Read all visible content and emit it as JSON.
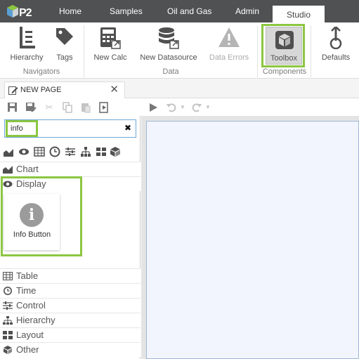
{
  "app": {
    "logo_text": "P2"
  },
  "nav": {
    "tabs": [
      "Home",
      "Samples",
      "Oil and Gas",
      "Admin",
      "Studio"
    ],
    "active": "Studio"
  },
  "ribbon": {
    "buttons": {
      "hierarchy": "Hierarchy",
      "tags": "Tags",
      "new_calc": "New Calc",
      "new_datasource": "New Datasource",
      "data_errors": "Data Errors",
      "toolbox": "Toolbox",
      "defaults": "Defaults"
    },
    "groups": {
      "navigators": "Navigators",
      "data": "Data",
      "components": "Components"
    }
  },
  "document_tab": {
    "title": "NEW PAGE",
    "close": "✕"
  },
  "search": {
    "value": "info"
  },
  "categories": {
    "chart": "Chart",
    "display": "Display",
    "table": "Table",
    "time": "Time",
    "control": "Control",
    "hierarchy": "Hierarchy",
    "layout": "Layout",
    "other": "Other"
  },
  "components": {
    "info_button": {
      "label": "Info Button",
      "glyph": "i"
    }
  },
  "colors": {
    "highlight": "#8cc641",
    "topbar": "#505152",
    "canvas": "#f2f5fd"
  }
}
